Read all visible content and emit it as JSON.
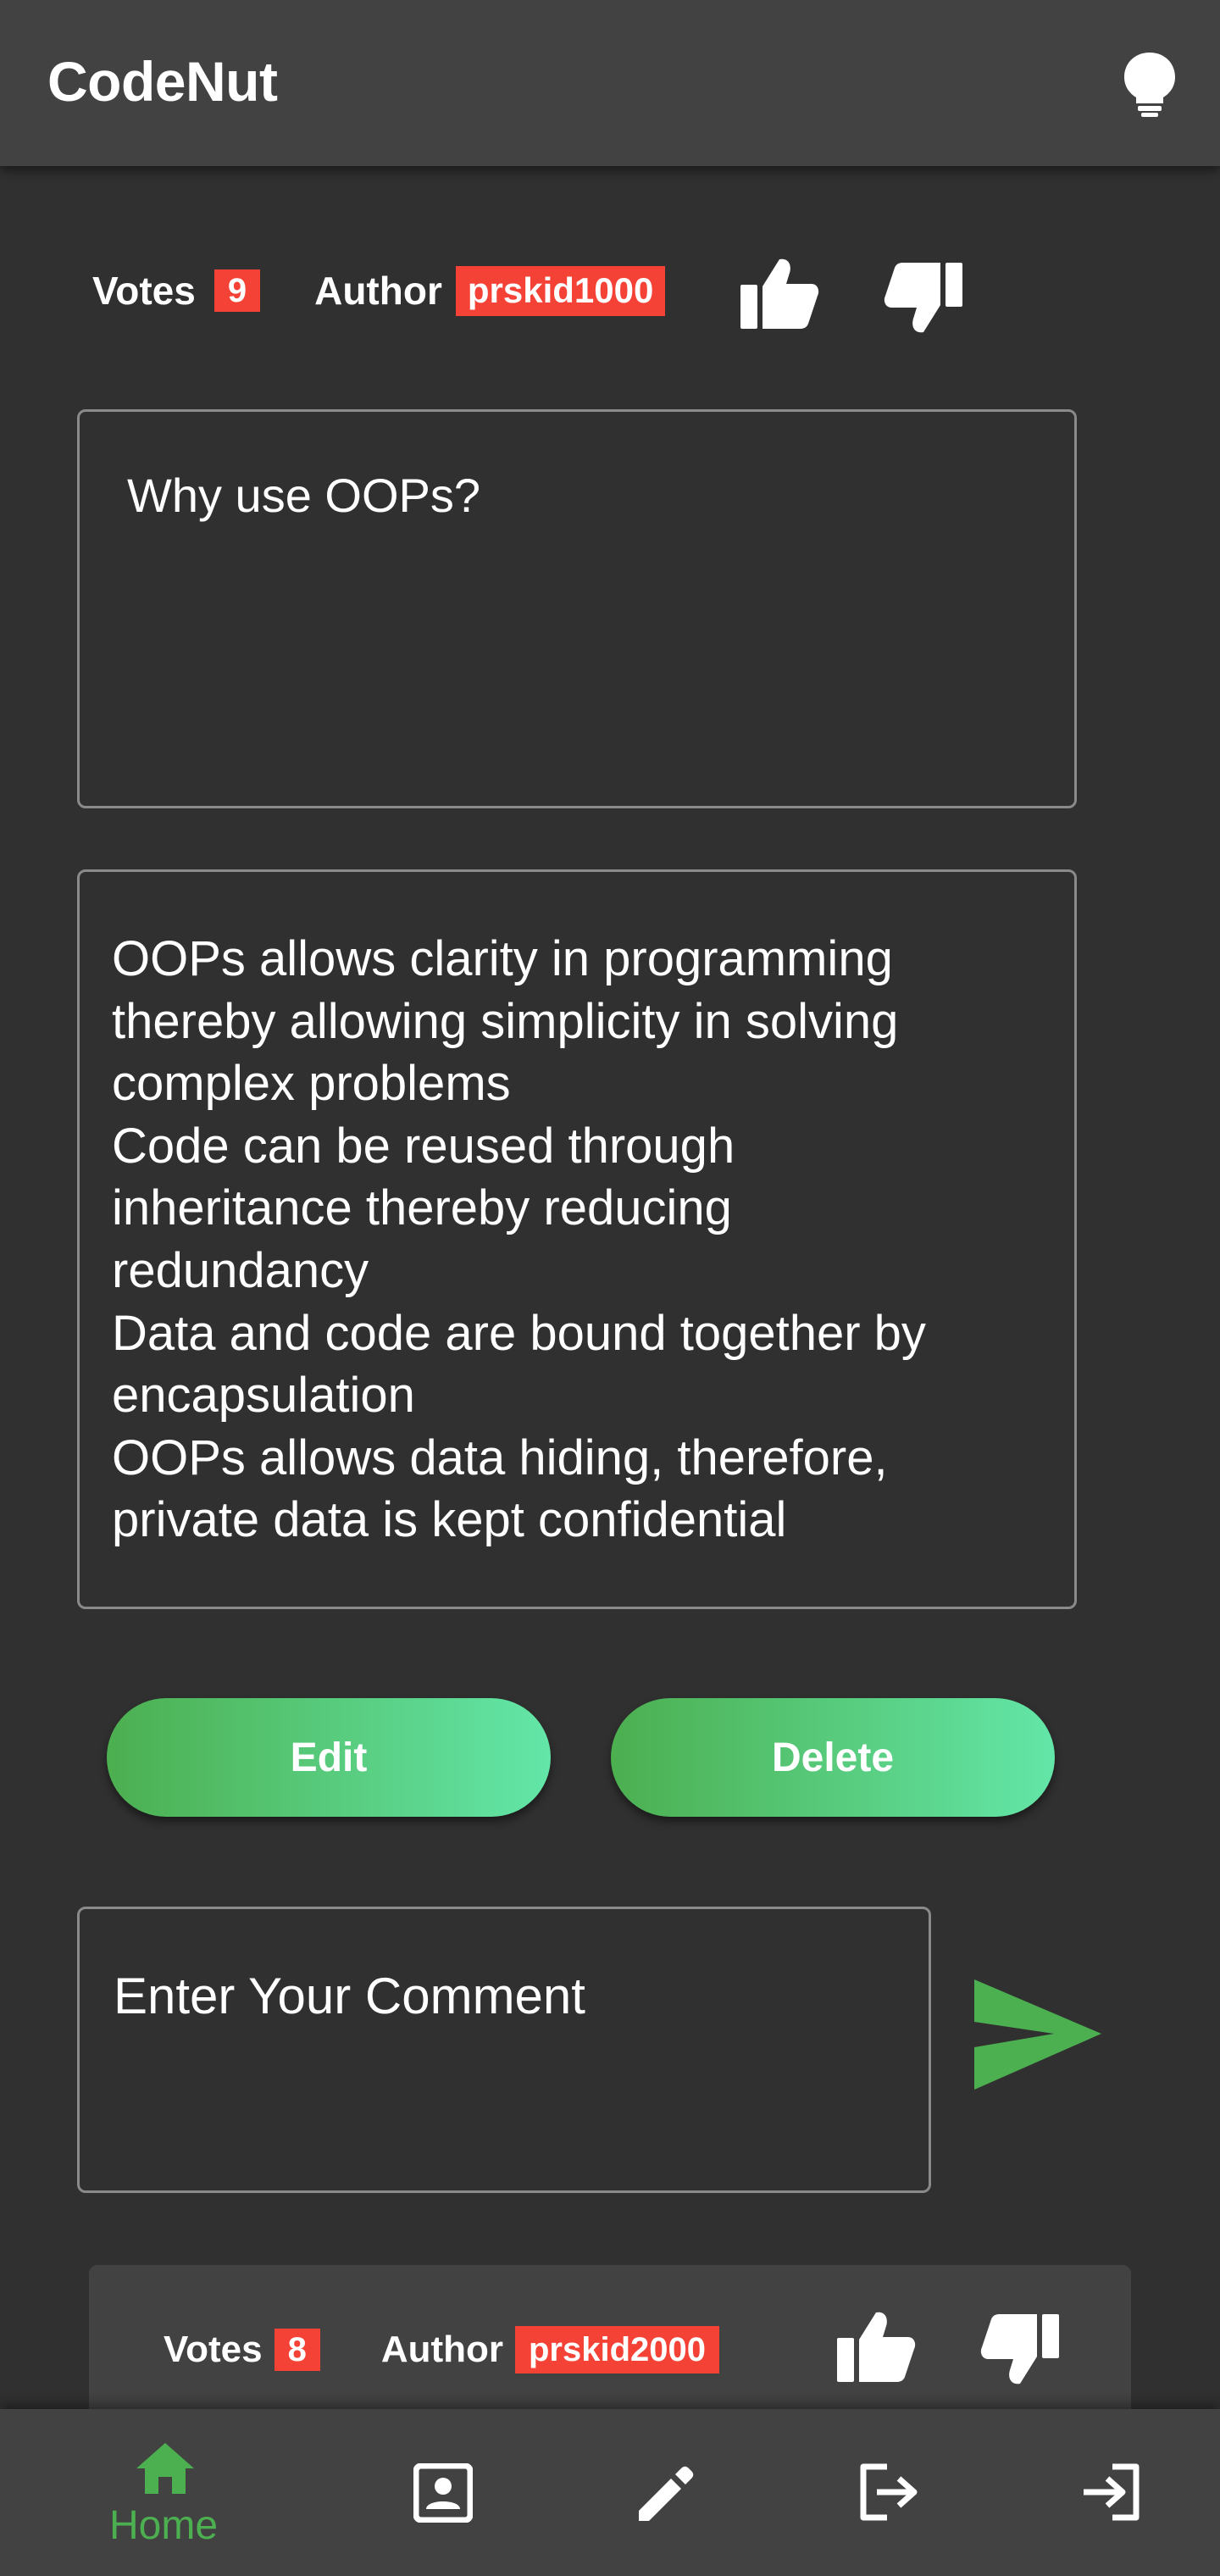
{
  "app": {
    "title": "CodeNut"
  },
  "question": {
    "votes_label": "Votes",
    "votes": "9",
    "author_label": "Author",
    "author": "prskid1000",
    "title": "Why use OOPs?",
    "answer_lines": [
      "OOPs allows clarity in programming",
      "thereby allowing simplicity in solving",
      "complex problems",
      "Code can be reused through",
      "inheritance thereby reducing",
      "redundancy",
      "Data and code are bound together by",
      "encapsulation",
      "OOPs allows data hiding, therefore,",
      "private data is kept confidential"
    ]
  },
  "actions": {
    "edit_label": "Edit",
    "delete_label": "Delete"
  },
  "comment_input": {
    "placeholder": "Enter Your Comment"
  },
  "comment": {
    "votes_label": "Votes",
    "votes": "8",
    "author_label": "Author",
    "author": "prskid2000"
  },
  "bottom_nav": {
    "items": [
      {
        "icon": "home-icon",
        "label": "Home",
        "active": true
      },
      {
        "icon": "contact-card-icon",
        "label": ""
      },
      {
        "icon": "pencil-icon",
        "label": ""
      },
      {
        "icon": "logout-icon",
        "label": ""
      },
      {
        "icon": "login-icon",
        "label": ""
      }
    ]
  },
  "colors": {
    "background": "#303030",
    "surface": "#424242",
    "accent_green": "#4caf50",
    "badge_red": "#f44336"
  }
}
